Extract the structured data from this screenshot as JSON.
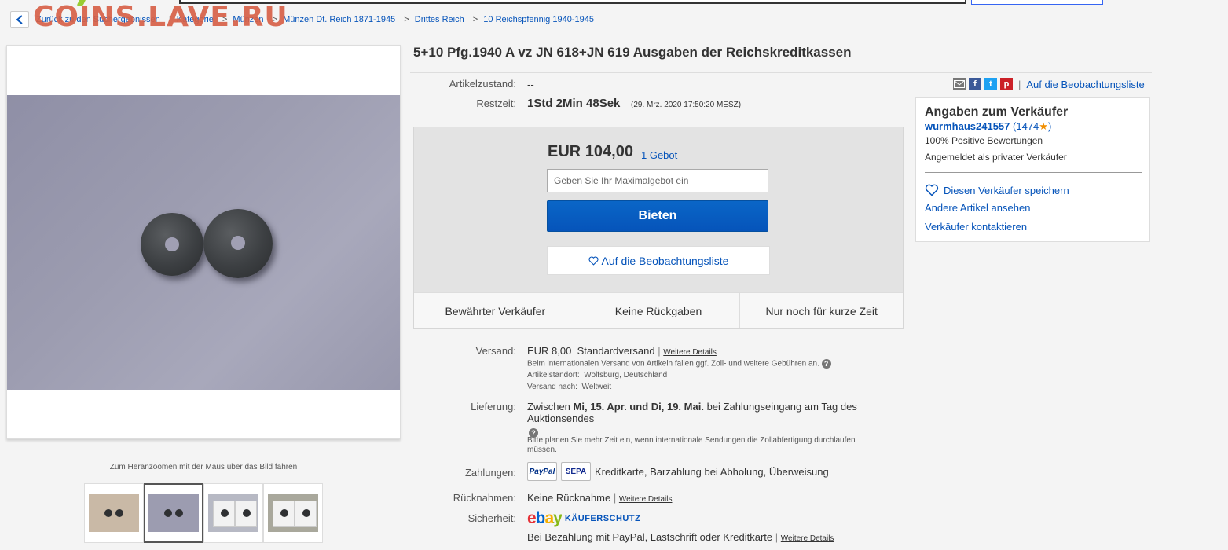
{
  "watermark": {
    "text": "COINS.LAVE.RU"
  },
  "breadcrumb": {
    "back_label": "Zurück zu den Suchergebnissen",
    "items": [
      "Kategorie",
      "Münzen",
      "Münzen Dt. Reich 1871-1945",
      "Drittes Reich",
      "10 Reichspfennig 1940-1945"
    ]
  },
  "gallery": {
    "zoom_hint": "Zum Heranzoomen mit der Maus über das Bild fahren",
    "thumbnail_count": 4,
    "active_thumbnail": 2
  },
  "listing": {
    "title": "5+10 Pfg.1940 A vz JN 618+JN 619 Ausgaben der Reichskreditkassen",
    "condition_label": "Artikelzustand:",
    "condition_value": "--",
    "time_label": "Restzeit:",
    "time_left": "1Std 2Min 48Sek",
    "end_time": "(29. Mrz. 2020   17:50:20 MESZ)"
  },
  "share": {
    "icons": [
      "email-icon",
      "facebook-icon",
      "twitter-icon",
      "pinterest-icon"
    ],
    "watchlist_label": "Auf die Beobachtungsliste"
  },
  "bid_panel": {
    "price": "EUR 104,00",
    "bids": "1 Gebot",
    "max_bid_placeholder": "Geben Sie Ihr Maximalgebot ein",
    "bid_button": "Bieten",
    "watch_button": "Auf die Beobachtungsliste",
    "features": [
      "Bewährter Verkäufer",
      "Keine Rückgaben",
      "Nur noch für kurze Zeit"
    ]
  },
  "seller": {
    "heading": "Angaben zum Verkäufer",
    "name": "wurmhaus241557",
    "score_open": "(1474",
    "score_close": ")",
    "positive": "100% Positive Bewertungen",
    "registered": "Angemeldet als privater Verkäufer",
    "save": "Diesen Verkäufer speichern",
    "other_items": "Andere Artikel ansehen",
    "contact": "Verkäufer kontaktieren"
  },
  "shipping": {
    "label": "Versand:",
    "cost": "EUR 8,00",
    "service": "Standardversand",
    "details": "Weitere Details",
    "intl_note": "Beim internationalen Versand von Artikeln fallen ggf. Zoll- und weitere Gebühren an.",
    "location_label": "Artikelstandort:",
    "location": "Wolfsburg, Deutschland",
    "ships_to_label": "Versand nach:",
    "ships_to": "Weltweit"
  },
  "delivery": {
    "label": "Lieferung:",
    "prefix": "Zwischen",
    "range": "Mi, 15. Apr. und Di, 19. Mai.",
    "suffix": "bei Zahlungseingang am Tag des",
    "suffix2": "Auktionsendes",
    "note": "Bitte planen Sie mehr Zeit ein, wenn internationale Sendungen die Zollabfertigung durchlaufen müssen."
  },
  "payments": {
    "label": "Zahlungen:",
    "logos": [
      "PayPal",
      "SEPA"
    ],
    "methods": "Kreditkarte, Barzahlung bei Abholung, Überweisung"
  },
  "returns": {
    "label": "Rücknahmen:",
    "value": "Keine Rücknahme",
    "details": "Weitere Details"
  },
  "security": {
    "label": "Sicherheit:",
    "logo": "ebay",
    "protection": "KÄUFERSCHUTZ",
    "note": "Bei Bezahlung mit PayPal, Lastschrift oder Kreditkarte",
    "details": "Weitere Details"
  },
  "colors": {
    "link": "#0654ba",
    "bid_button": "#0654ba",
    "star": "#f18e00",
    "watermark": "#d66046"
  }
}
